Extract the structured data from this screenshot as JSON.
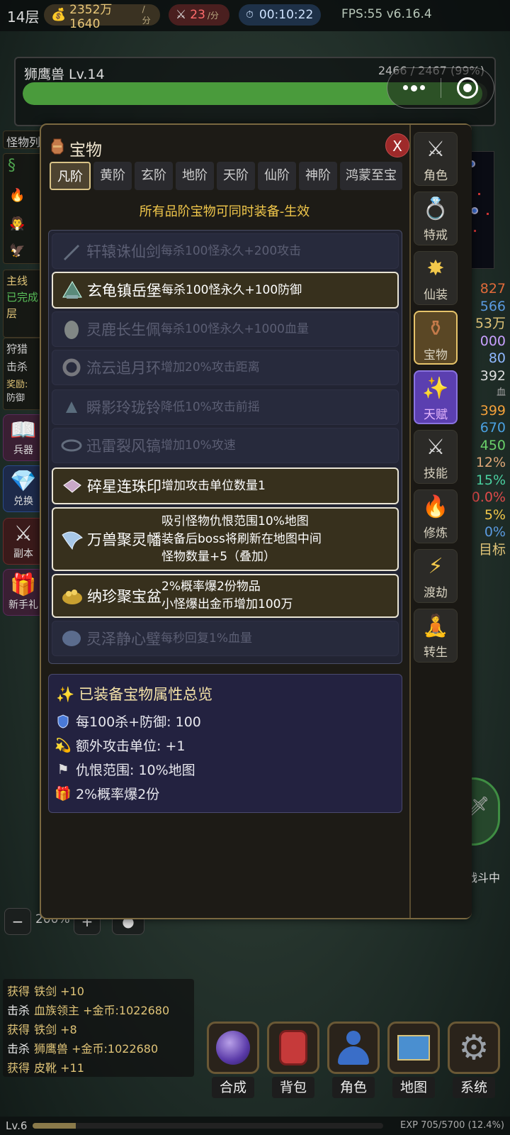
{
  "topbar": {
    "floor": "14层",
    "gold": "2352万1640",
    "gold_unit": "/分",
    "atk": "23",
    "atk_unit": "/分",
    "timer": "00:10:22",
    "fps": "FPS:55 v6.16.4"
  },
  "boss": {
    "name": "狮鹰兽 Lv.14",
    "hp": "2466 / 2467 (99%)",
    "hp_fraction": 0.99
  },
  "left": {
    "monster_tab": "怪物列",
    "quest_title": "主线",
    "quest_line1": "已完成",
    "quest_line2": "层",
    "hunt_title": "狩猎",
    "hunt_line": "击杀",
    "hunt_reward": "奖励:",
    "hunt_def": "防御",
    "buttons": [
      "兵器",
      "兑换",
      "副本",
      "新手礼"
    ]
  },
  "right_stats": [
    "827",
    "566",
    "53万",
    "000",
    "80",
    "392",
    "血",
    "399",
    "670",
    "450",
    "12%",
    "15%",
    "0.0%",
    "5%",
    "0%",
    "目标"
  ],
  "modal": {
    "title": "宝物",
    "close": "X",
    "tabs": [
      "凡阶",
      "黄阶",
      "玄阶",
      "地阶",
      "天阶",
      "仙阶",
      "神阶",
      "鸿蒙至宝"
    ],
    "subtitle": "所有品阶宝物可同时装备-生效",
    "items": [
      {
        "name": "轩辕诛仙剑",
        "desc": "每杀100怪永久+200攻击",
        "equipped": false
      },
      {
        "name": "玄龟镇岳堡",
        "desc": "每杀100怪永久+100防御",
        "equipped": true
      },
      {
        "name": "灵鹿长生佩",
        "desc": "每杀100怪永久+1000血量",
        "equipped": false
      },
      {
        "name": "流云追月环",
        "desc": "增加20%攻击距离",
        "equipped": false
      },
      {
        "name": "瞬影玲珑铃",
        "desc": "降低10%攻击前摇",
        "equipped": false
      },
      {
        "name": "迅雷裂风镐",
        "desc": "增加10%攻速",
        "equipped": false
      },
      {
        "name": "碎星连珠印",
        "desc": "增加攻击单位数量1",
        "equipped": true
      },
      {
        "name": "万兽聚灵幡",
        "desc1": "吸引怪物仇恨范围10%地图",
        "desc2": "装备后boss将刷新在地图中间",
        "desc3": "怪物数量+5（叠加）",
        "equipped": true
      },
      {
        "name": "纳珍聚宝盆",
        "desc1": "2%概率爆2份物品",
        "desc2": "小怪爆出金币增加100万",
        "equipped": true
      },
      {
        "name": "灵泽静心璧",
        "desc": "每秒回复1%血量",
        "equipped": false
      }
    ],
    "summary": {
      "title": "已装备宝物属性总览",
      "rows": [
        "每100杀+防御: 100",
        "额外攻击单位: +1",
        "仇恨范围: 10%地图",
        "2%概率爆2份"
      ]
    },
    "nav": [
      "角色",
      "特戒",
      "仙装",
      "宝物",
      "天赋",
      "技能",
      "修炼",
      "渡劫",
      "转生"
    ]
  },
  "zoom": {
    "minus": "−",
    "value": "200%",
    "plus": "+"
  },
  "battle_label": "战斗中",
  "log": [
    {
      "a": "获得",
      "b": "铁剑 +10"
    },
    {
      "a": "击杀",
      "b": "血族领主 +金币:1022680"
    },
    {
      "a": "获得",
      "b": "铁剑 +8"
    },
    {
      "a": "击杀",
      "b": "狮鹰兽 +金币:1022680"
    },
    {
      "a": "获得",
      "b": "皮靴 +11"
    }
  ],
  "bottom_nav": [
    "合成",
    "背包",
    "角色",
    "地图",
    "系统"
  ],
  "xp": {
    "level": "Lv.6",
    "text": "EXP 705/5700 (12.4%)",
    "fraction": 0.124
  }
}
